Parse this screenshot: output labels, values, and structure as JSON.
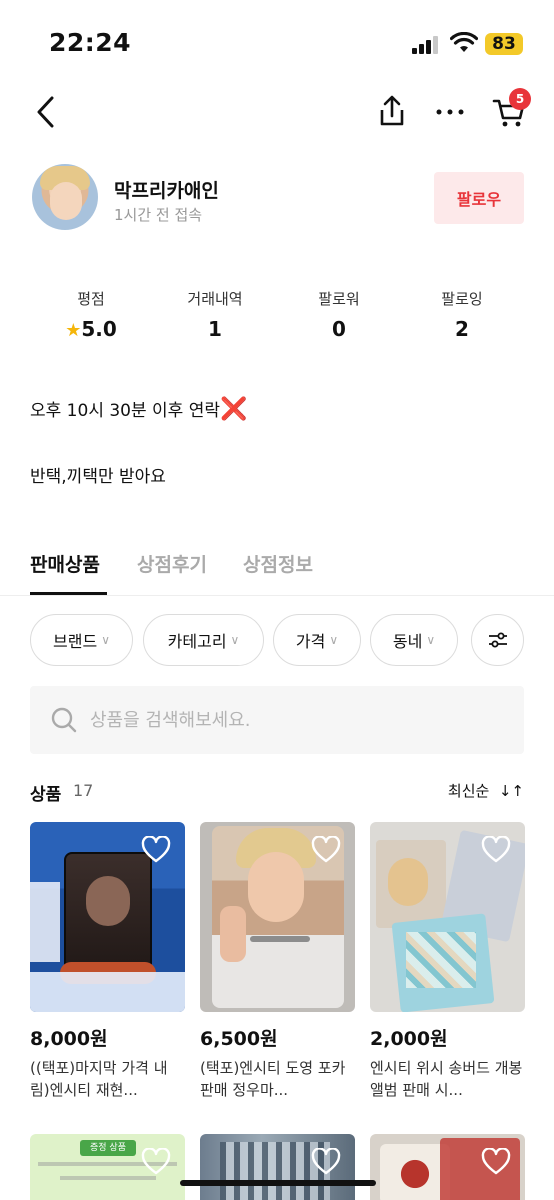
{
  "status": {
    "time": "22:24",
    "battery": "83"
  },
  "nav": {
    "cart_count": "5"
  },
  "profile": {
    "name": "막프리카애인",
    "last_seen": "1시간 전 접속",
    "follow_label": "팔로우"
  },
  "stats": [
    {
      "label": "평점",
      "value": "5.0"
    },
    {
      "label": "거래내역",
      "value": "1"
    },
    {
      "label": "팔로워",
      "value": "0"
    },
    {
      "label": "팔로잉",
      "value": "2"
    }
  ],
  "bio": {
    "line1": "오후 10시 30분 이후 연락",
    "line1_emoji": "❌",
    "line2": "반택,끼택만 받아요"
  },
  "tabs": [
    "판매상품",
    "상점후기",
    "상점정보"
  ],
  "filters": [
    "브랜드",
    "카테고리",
    "가격",
    "동네"
  ],
  "search": {
    "placeholder": "상품을 검색해보세요."
  },
  "list": {
    "title": "상품",
    "count": "17",
    "sort_label": "최신순"
  },
  "products": [
    {
      "price": "8,000원",
      "name": "((택포)마지막 가격 내림)엔시티 재현..."
    },
    {
      "price": "6,500원",
      "name": "(택포)엔시티 도영 포카 판매 정우마..."
    },
    {
      "price": "2,000원",
      "name": "엔시티 위시 송버드 개봉앨범 판매 시..."
    }
  ],
  "row2_label": "증정 상품",
  "colors": {
    "accent": "#e8343a",
    "follow_bg": "#fde9ea"
  }
}
